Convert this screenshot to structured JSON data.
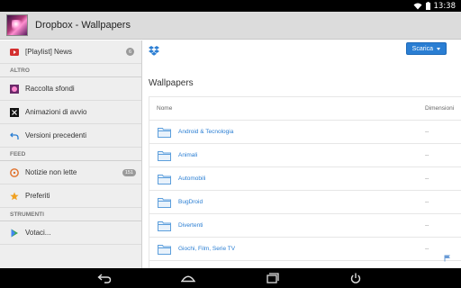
{
  "status_bar": {
    "time": "13:38"
  },
  "action_bar": {
    "title": "Dropbox - Wallpapers"
  },
  "drawer": {
    "playlist_item": {
      "label": "[Playlist] News",
      "badge": "6"
    },
    "altro_header": "ALTRO",
    "altro_items": [
      {
        "label": "Raccolta sfondi",
        "icon": "wallpaper-icon"
      },
      {
        "label": "Animazioni di avvio",
        "icon": "boot-animation-icon"
      },
      {
        "label": "Versioni precedenti",
        "icon": "undo-icon"
      }
    ],
    "feed_header": "FEED",
    "feed_items": [
      {
        "label": "Notizie non lette",
        "icon": "rss-icon",
        "badge": "151"
      },
      {
        "label": "Preferiti",
        "icon": "star-icon"
      }
    ],
    "strumenti_header": "STRUMENTI",
    "strumenti_items": [
      {
        "label": "Votaci...",
        "icon": "play-store-icon"
      }
    ]
  },
  "main": {
    "download_button": "Scarica",
    "folder_title": "Wallpapers",
    "table": {
      "col_name": "Nome",
      "col_dim": "Dimensioni",
      "rows": [
        {
          "name": "Android & Tecnologia",
          "dim": "--"
        },
        {
          "name": "Animali",
          "dim": "--"
        },
        {
          "name": "Automobili",
          "dim": "--"
        },
        {
          "name": "BugDroid",
          "dim": "--"
        },
        {
          "name": "Divertenti",
          "dim": "--"
        },
        {
          "name": "Giochi, Film, Serie TV",
          "dim": "--"
        }
      ]
    }
  },
  "colors": {
    "accent": "#2a7ed3",
    "action_bar": "#dcdcdc",
    "drawer_bg": "#eeeeee"
  }
}
